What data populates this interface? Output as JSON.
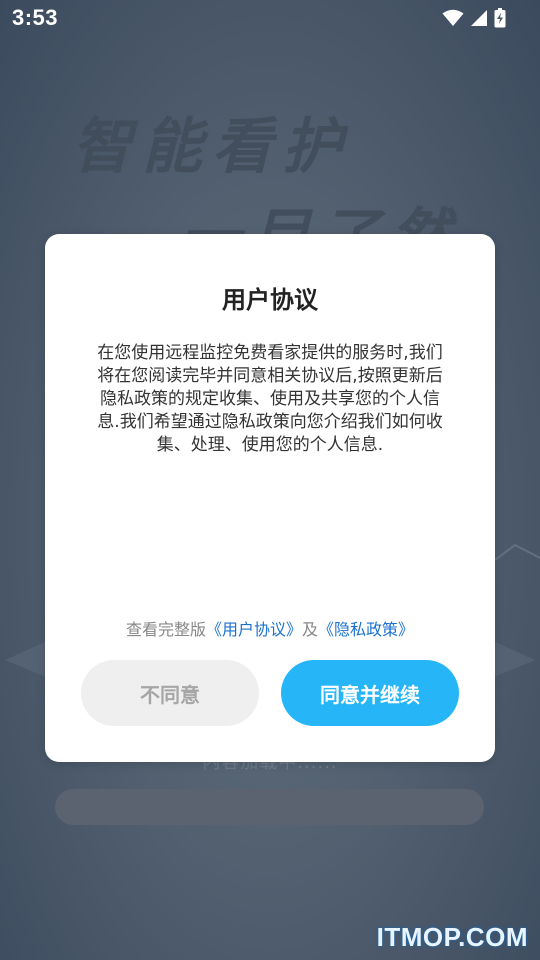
{
  "status_bar": {
    "time": "3:53",
    "icons": [
      "wifi-icon",
      "cellular-signal-icon",
      "battery-charging-icon"
    ]
  },
  "background": {
    "slogan_line1": "智能看护",
    "slogan_line2": "一目了然",
    "loading_text": "内容加载中......",
    "loading_progress_percent": 0,
    "watermark": "ITMOP.COM"
  },
  "dialog": {
    "title": "用户协议",
    "body_lines": [
      "在您使用远程监控免费看家提供的服务时,我们",
      "将在您阅读完毕并同意相关协议后,按照更新后",
      "隐私政策的规定收集、使用及共享您的个人信",
      "息.我们希望通过隐私政策向您介绍我们如何收",
      "集、处理、使用您的个人信息."
    ],
    "links": {
      "prefix": "查看完整版",
      "user_agreement": "《用户协议》",
      "connector": "及",
      "privacy_policy": "《隐私政策》"
    },
    "buttons": {
      "disagree": "不同意",
      "agree": "同意并继续"
    }
  },
  "colors": {
    "agree_button": "#26b6f8",
    "disagree_button": "#efefef",
    "link": "#1b73cf",
    "background": "#566272"
  }
}
